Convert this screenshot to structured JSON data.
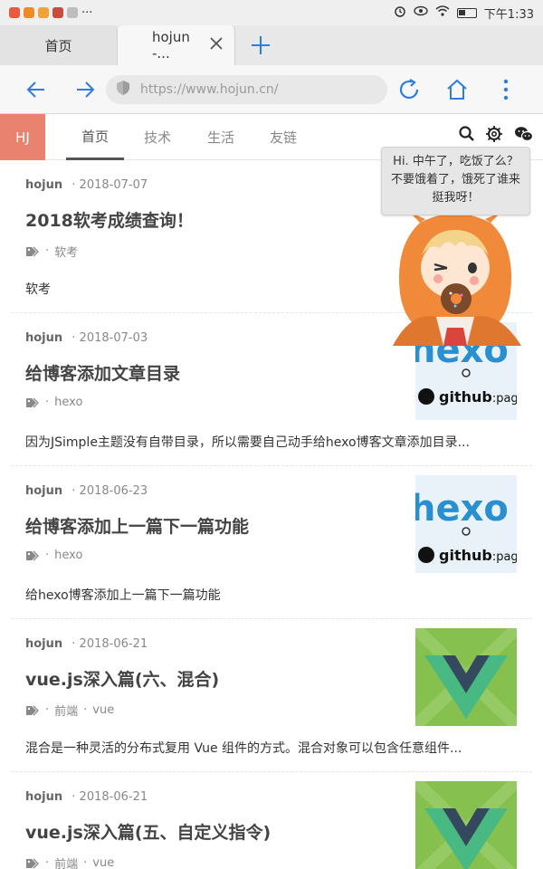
{
  "status_bar": {
    "time": "下午1:33",
    "dots": "···"
  },
  "tabs": [
    {
      "label": "首页"
    },
    {
      "label": "hojun -..."
    }
  ],
  "toolbar": {
    "url": "https://www.hojun.cn/"
  },
  "site": {
    "logo": "HJ",
    "nav": [
      "首页",
      "技术",
      "生活",
      "友链"
    ]
  },
  "bubble": {
    "text": "Hi. 中午了，吃饭了么？不要饿着了，饿死了谁来挺我呀！"
  },
  "posts": [
    {
      "author": "hojun",
      "date": "· 2018-07-07",
      "title": "2018软考成绩查询！",
      "tags": [
        "软考"
      ],
      "excerpt": "软考"
    },
    {
      "author": "hojun",
      "date": "· 2018-07-03",
      "title": "给博客添加文章目录",
      "tags": [
        "hexo"
      ],
      "excerpt": "因为JSimple主题没有自带目录，所以需要自己动手给hexo博客文章添加目录...",
      "thumb": {
        "big": "hexo",
        "small": "github",
        "suffix": ":pag"
      }
    },
    {
      "author": "hojun",
      "date": "· 2018-06-23",
      "title": "给博客添加上一篇下一篇功能",
      "tags": [
        "hexo"
      ],
      "excerpt": "给hexo博客添加上一篇下一篇功能",
      "thumb": {
        "big": "hexo",
        "small": "github",
        "suffix": ":pag"
      }
    },
    {
      "author": "hojun",
      "date": "· 2018-06-21",
      "title": "vue.js深入篇(六、混合)",
      "tags": [
        "前端",
        "vue"
      ],
      "excerpt": "混合是一种灵活的分布式复用 Vue 组件的方式。混合对象可以包含任意组件..."
    },
    {
      "author": "hojun",
      "date": "· 2018-06-21",
      "title": "vue.js深入篇(五、自定义指令)",
      "tags": [
        "前端",
        "vue"
      ],
      "excerpt": ""
    }
  ],
  "colors": {
    "accent_blue": "#2b7ee0",
    "logo_bg": "#e9836f"
  }
}
